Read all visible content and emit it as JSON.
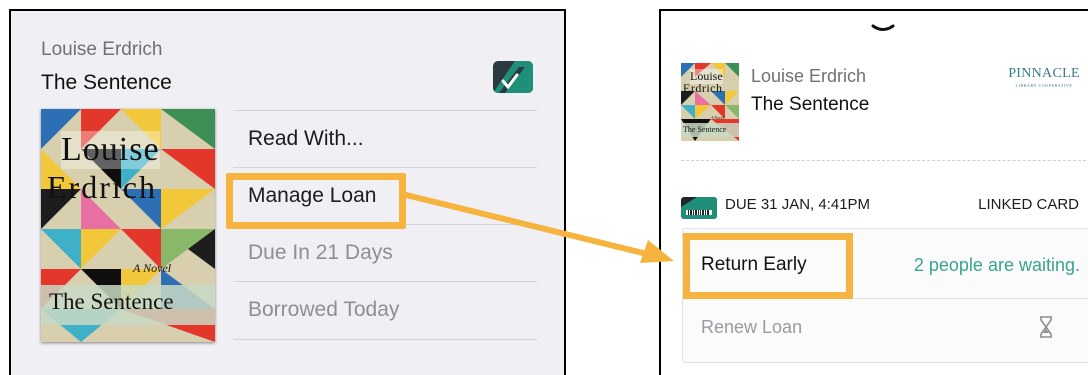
{
  "left_panel": {
    "author": "Louise Erdrich",
    "title": "The Sentence",
    "app_icon": "app-logo-icon",
    "cover": {
      "line1": "Louise",
      "line2": "Erdrich",
      "tag": "A Novel",
      "book_title": "The Sentence"
    },
    "menu": [
      {
        "label": "Read With..."
      },
      {
        "label": "Manage Loan"
      },
      {
        "label": "Due In 21 Days"
      },
      {
        "label": "Borrowed Today"
      }
    ]
  },
  "right_panel": {
    "collapse_icon": "chevron-down-icon",
    "author": "Louise Erdrich",
    "title": "The Sentence",
    "cover": {
      "line1": "Louise",
      "line2": "Erdrich",
      "tag": "A Novel",
      "book_title": "The Sentence"
    },
    "library": {
      "name": "PINNACLE",
      "subtitle": "LIBRARY COOPERATIVE"
    },
    "due": "DUE 31 JAN, 4:41PM",
    "card_label": "LINKED CARD",
    "return_label": "Return Early",
    "waiting_text": "2 people are waiting.",
    "renew_label": "Renew Loan",
    "renew_icon": "hourglass-icon"
  },
  "colors": {
    "highlight": "#f6b43e",
    "teal": "#3aa38f",
    "panel_bg": "#efeff4"
  }
}
